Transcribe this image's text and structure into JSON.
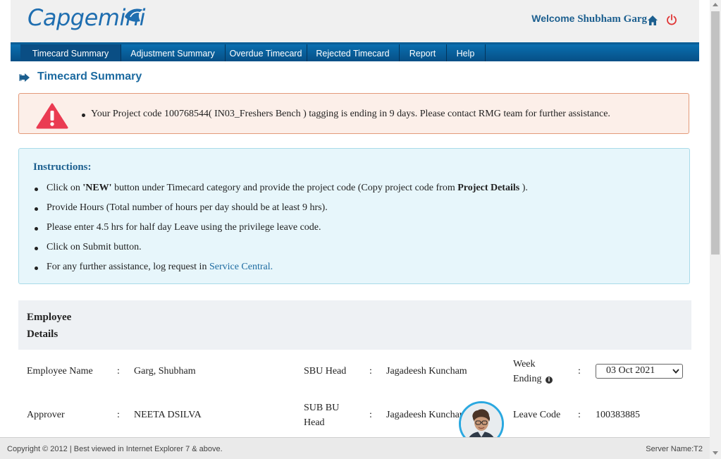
{
  "header": {
    "logo_text": "Capgemini",
    "welcome_label": "Welcome",
    "user_name": "Shubham Garg"
  },
  "nav": {
    "items": [
      {
        "label": "Timecard Summary"
      },
      {
        "label": "Adjustment Summary"
      },
      {
        "label": "Overdue Timecard"
      },
      {
        "label": "Rejected Timecard"
      },
      {
        "label": "Report"
      },
      {
        "label": "Help"
      }
    ]
  },
  "page": {
    "title": "Timecard Summary"
  },
  "alert": {
    "message": "Your Project code 100768544( IN03_Freshers Bench ) tagging is ending in 9 days. Please contact RMG team for further assistance."
  },
  "instructions": {
    "title": "Instructions:",
    "item1_a": "Click on ",
    "item1_b": "'NEW'",
    "item1_c": " button under Timecard category and provide the project code (Copy project code from ",
    "item1_d": "Project Details",
    "item1_e": " ).",
    "item2": "Provide Hours (Total number of hours per day should be at least 9 hrs).",
    "item3": "Please enter 4.5 hrs for half day Leave using the privilege leave code.",
    "item4": "Click on Submit button.",
    "item5_a": "For any further assistance, log request in ",
    "item5_link": "Service Central."
  },
  "employee": {
    "section_title": "Employee Details",
    "colon": ":",
    "employee_name_label": "Employee Name",
    "employee_name_value": "Garg, Shubham",
    "sbu_head_label": "SBU Head",
    "sbu_head_value": "Jagadeesh Kuncham",
    "week_ending_label": "Week Ending",
    "week_ending_value": "03 Oct 2021",
    "approver_label": "Approver",
    "approver_value": "NEETA DSILVA",
    "sub_bu_head_label": "SUB BU Head",
    "sub_bu_head_value": "Jagadeesh Kuncham",
    "leave_code_label": "Leave Code",
    "leave_code_value": "100383885"
  },
  "footer": {
    "copyright": "Copyright © 2012 | Best viewed in Internet Explorer 7 & above.",
    "server_name": "Server Name:T2"
  },
  "colors": {
    "brand_blue": "#1f6eb0",
    "nav_blue": "#0a6fb0",
    "alert_red": "#ea3b52",
    "info_bg": "#e7f6fb"
  }
}
